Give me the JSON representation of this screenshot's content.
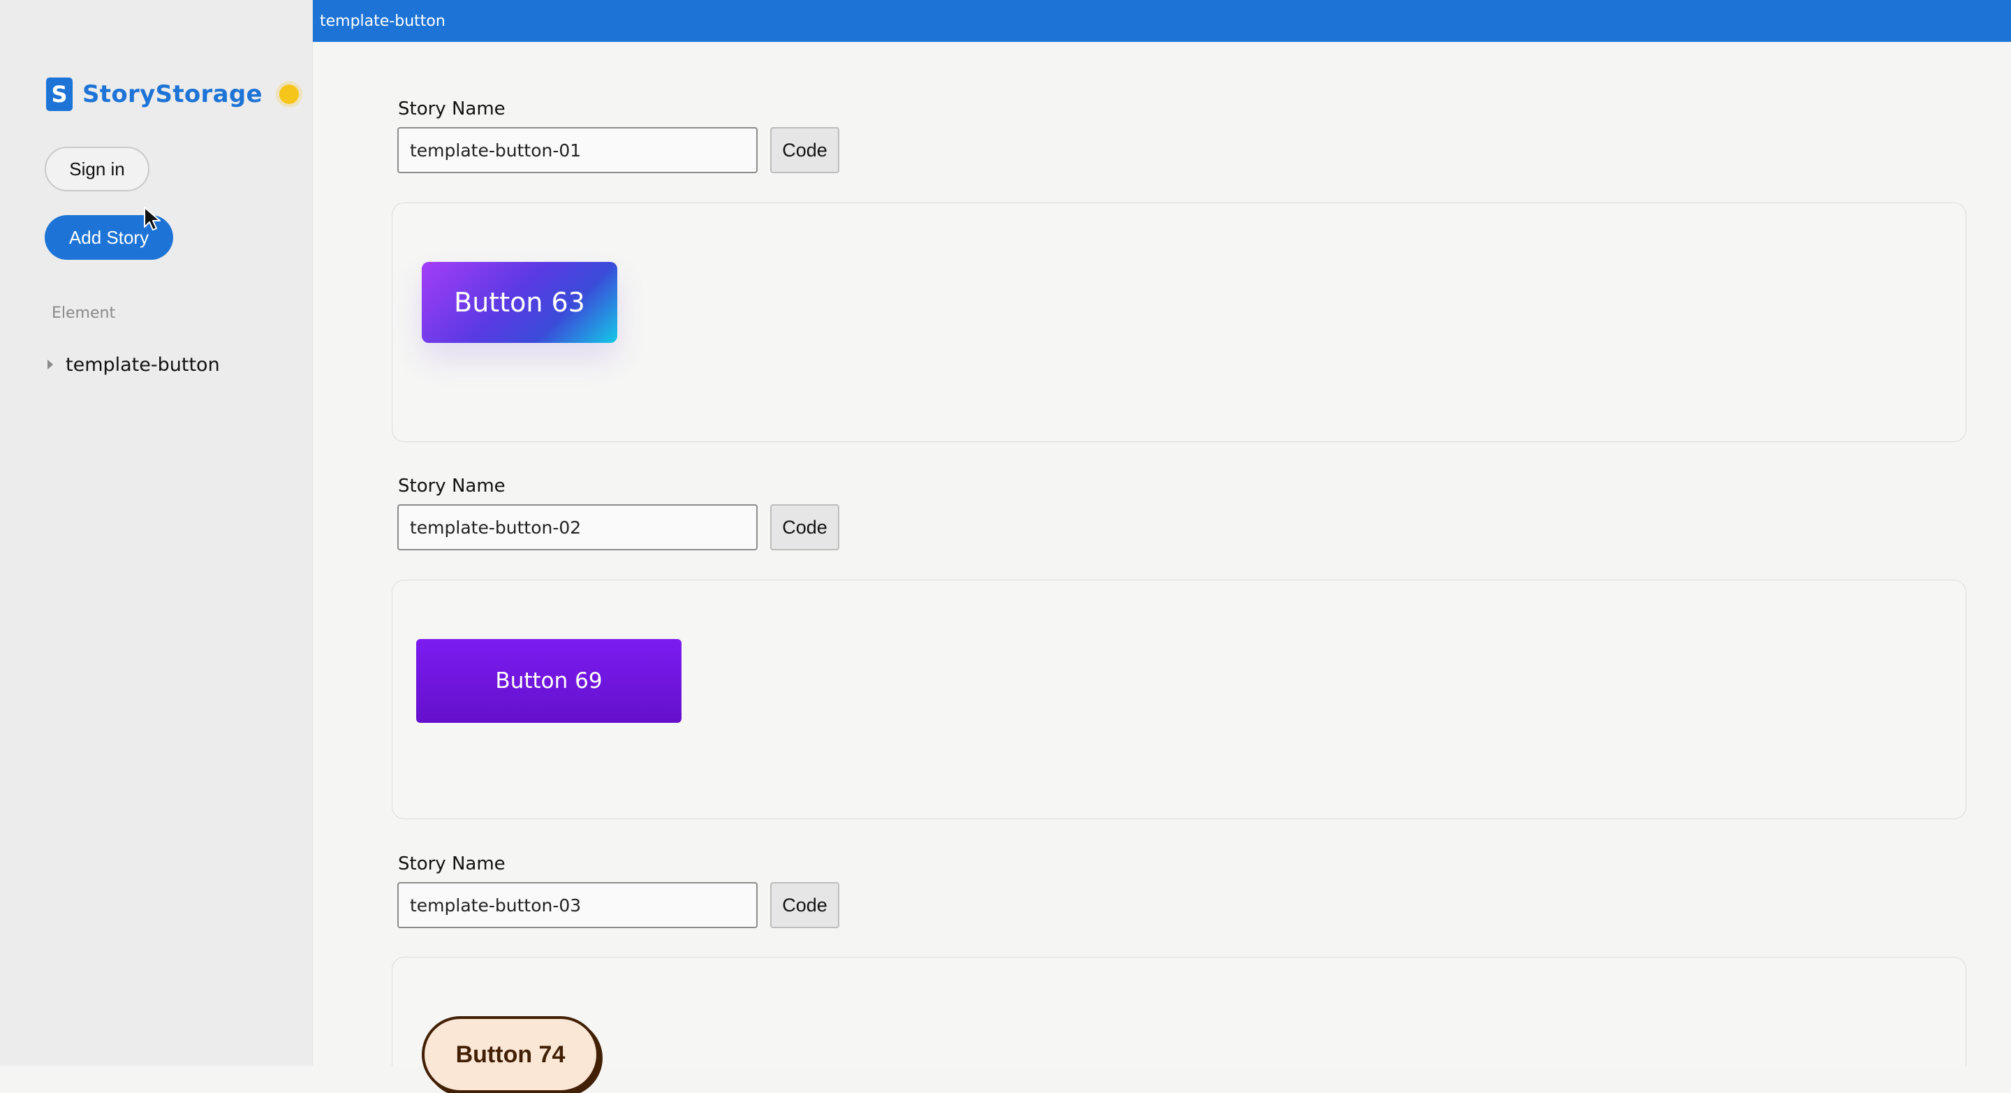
{
  "app": {
    "logo_letter": "S",
    "name": "StoryStorage",
    "theme_icon": "sun-icon",
    "brand_color": "#1e74d6"
  },
  "sidebar": {
    "sign_in_label": "Sign in",
    "add_story_label": "Add Story",
    "section_label": "Element",
    "tree_items": [
      {
        "label": "template-button",
        "icon": "caret-right-icon"
      }
    ]
  },
  "topbar": {
    "title": "template-button"
  },
  "stories": [
    {
      "name_label": "Story Name",
      "name_value": "template-button-01",
      "code_label": "Code",
      "preview_button_label": "Button 63"
    },
    {
      "name_label": "Story Name",
      "name_value": "template-button-02",
      "code_label": "Code",
      "preview_button_label": "Button 69"
    },
    {
      "name_label": "Story Name",
      "name_value": "template-button-03",
      "code_label": "Code",
      "preview_button_label": "Button 74"
    }
  ]
}
